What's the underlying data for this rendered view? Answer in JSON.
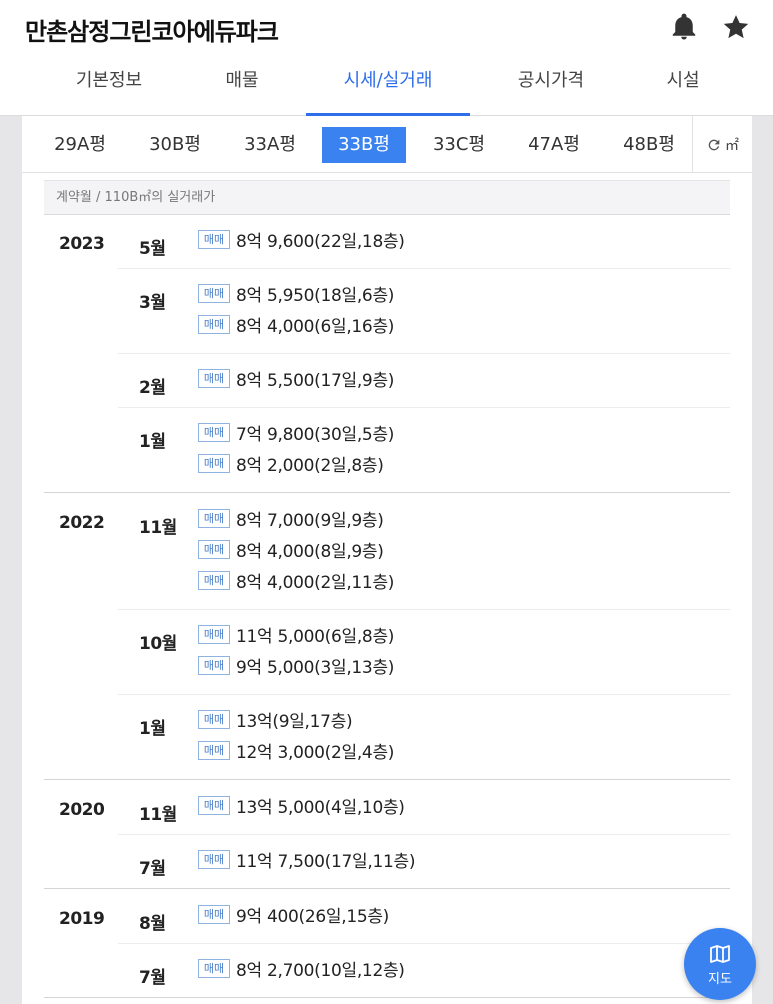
{
  "header": {
    "title": "만촌삼정그린코아에듀파크",
    "tabs": [
      "기본정보",
      "매물",
      "시세/실거래",
      "공시가격",
      "시설"
    ],
    "active_tab": 2
  },
  "sizes": {
    "items": [
      "29A평",
      "30B평",
      "33A평",
      "33B평",
      "33C평",
      "47A평",
      "48B평"
    ],
    "active": 3,
    "unit_label": "㎡"
  },
  "caption": "계약월 / 110B㎡의 실거래가",
  "badge_label": "매매",
  "groups": [
    {
      "year": "2023",
      "months": [
        {
          "month": "5월",
          "deals": [
            "8억 9,600(22일,18층)"
          ]
        },
        {
          "month": "3월",
          "deals": [
            "8억 5,950(18일,6층)",
            "8억 4,000(6일,16층)"
          ]
        },
        {
          "month": "2월",
          "deals": [
            "8억 5,500(17일,9층)"
          ]
        },
        {
          "month": "1월",
          "deals": [
            "7억 9,800(30일,5층)",
            "8억 2,000(2일,8층)"
          ]
        }
      ]
    },
    {
      "year": "2022",
      "months": [
        {
          "month": "11월",
          "deals": [
            "8억 7,000(9일,9층)",
            "8억 4,000(8일,9층)",
            "8억 4,000(2일,11층)"
          ]
        },
        {
          "month": "10월",
          "deals": [
            "11억 5,000(6일,8층)",
            "9억 5,000(3일,13층)"
          ]
        },
        {
          "month": "1월",
          "deals": [
            "13억(9일,17층)",
            "12억 3,000(2일,4층)"
          ]
        }
      ]
    },
    {
      "year": "2020",
      "months": [
        {
          "month": "11월",
          "deals": [
            "13억 5,000(4일,10층)"
          ]
        },
        {
          "month": "7월",
          "deals": [
            "11억 7,500(17일,11층)"
          ]
        }
      ]
    },
    {
      "year": "2019",
      "months": [
        {
          "month": "8월",
          "deals": [
            "9억 400(26일,15층)"
          ]
        },
        {
          "month": "7월",
          "deals": [
            "8억 2,700(10일,12층)"
          ]
        }
      ]
    }
  ],
  "map_button": {
    "label": "지도"
  },
  "colors": {
    "accent": "#3a82f0",
    "tab_active": "#2f6ee9",
    "badge": "#4a7fc9"
  }
}
